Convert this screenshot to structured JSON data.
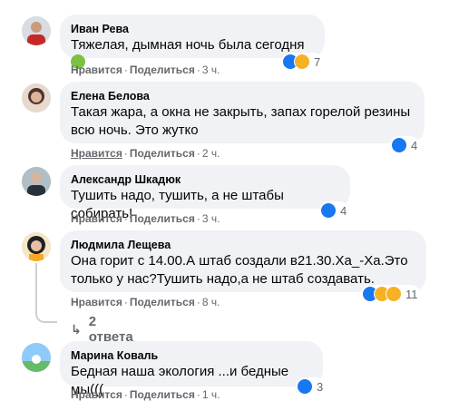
{
  "comments": [
    {
      "author": "Иван Рева",
      "text": "Тяжелая, дымная ночь была сегодня",
      "like": "Нравится",
      "reply": "Поделиться",
      "time": "3 ч.",
      "reaction_count": "7",
      "reactions": [
        "like-icon",
        "sad-icon"
      ]
    },
    {
      "author": "Елена Белова",
      "text": "Такая жара, а окна не закрыть, запах горелой резины всю ночь. Это жутко",
      "like": "Нравится",
      "reply": "Поделиться",
      "time": "2 ч.",
      "reaction_count": "4",
      "reactions": [
        "like-icon"
      ]
    },
    {
      "author": "Александр Шкадюк",
      "text": "Тушить надо, тушить, а не штабы собирать!",
      "like": "Нравится",
      "reply": "Поделиться",
      "time": "3 ч.",
      "reaction_count": "4",
      "reactions": [
        "like-icon"
      ]
    },
    {
      "author": "Людмила Лещева",
      "text": "Она горит с 14.00.А штаб создали в21.30.Ха_-Ха.Это только у нас?Тушить надо,а не штаб создавать.",
      "like": "Нравится",
      "reply": "Поделиться",
      "time": "8 ч.",
      "reaction_count": "11",
      "reactions": [
        "like-icon",
        "haha-icon",
        "wow-icon"
      ],
      "replies_label": "2 ответа"
    },
    {
      "author": "Марина Коваль",
      "text": "Бедная наша экология ...и бедные мы(((",
      "like": "Нравится",
      "reply": "Поделиться",
      "time": "1 ч.",
      "reaction_count": "3",
      "reactions": [
        "like-icon"
      ]
    }
  ],
  "colors": {
    "bubble": "#f0f2f5",
    "meta": "#65676b",
    "like": "#1877f2",
    "haha": "#f7b125"
  }
}
